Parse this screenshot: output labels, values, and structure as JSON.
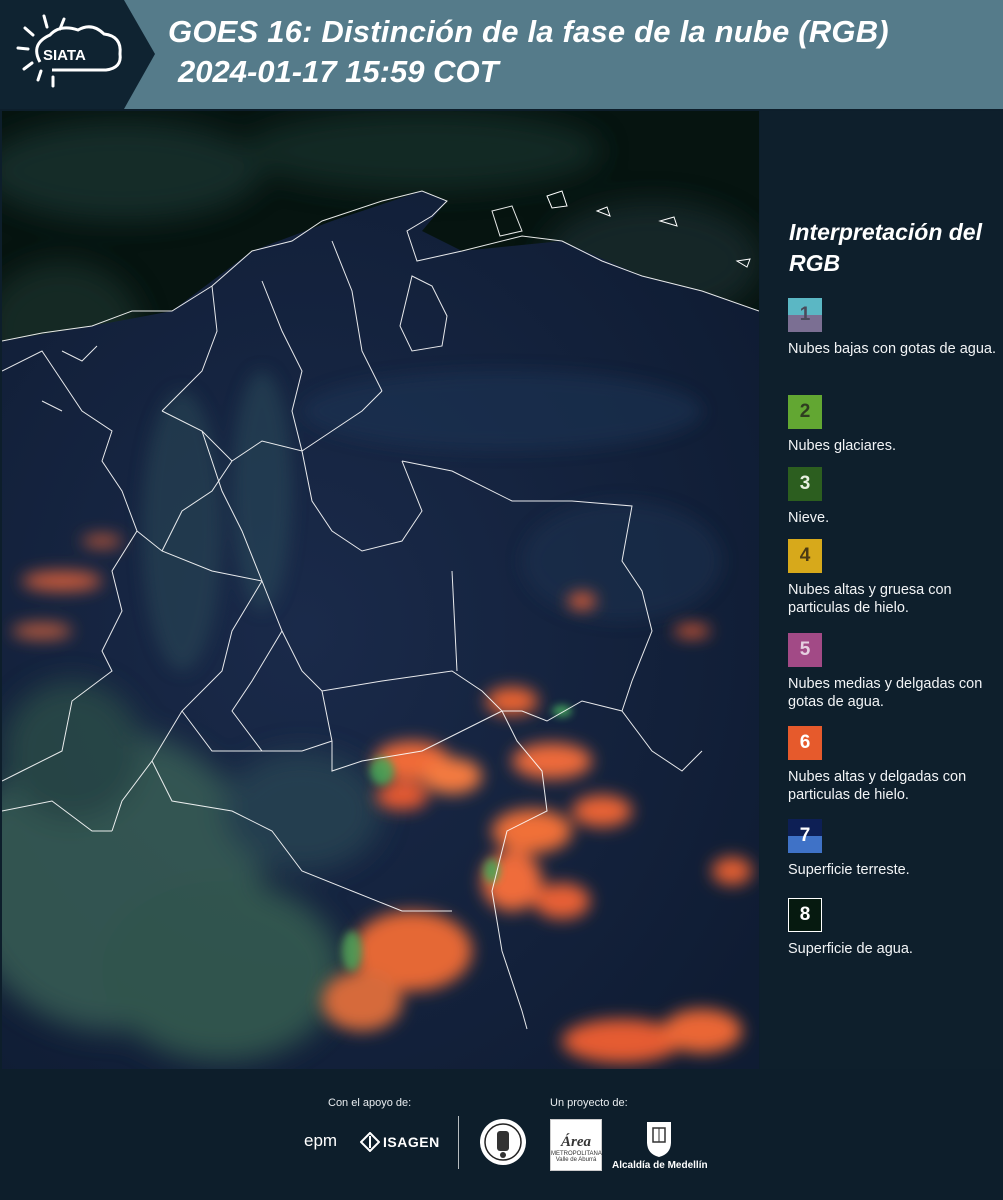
{
  "header": {
    "logo_text": "SIATA",
    "title_line1": "GOES 16: Distinción de la fase de la nube (RGB)",
    "title_line2": "2024-01-17 15:59 COT",
    "background_color": "#557b8a",
    "logo_panel_color": "#0f2331"
  },
  "map": {
    "icon": "satellite-map-image"
  },
  "legend": {
    "title": "Interpretación del RGB",
    "items": [
      {
        "number": "1",
        "label": "Nubes bajas con gotas de agua.",
        "colors": [
          "#5bb7c4",
          "#7b6f93"
        ]
      },
      {
        "number": "2",
        "label": "Nubes glaciares.",
        "colors": [
          "#62a732"
        ]
      },
      {
        "number": "3",
        "label": "Nieve.",
        "colors": [
          "#2c5e1f"
        ]
      },
      {
        "number": "4",
        "label": "Nubes altas y gruesa con particulas de hielo.",
        "colors": [
          "#d7a91b"
        ]
      },
      {
        "number": "5",
        "label": "Nubes medias y delgadas con gotas de agua.",
        "colors": [
          "#a24a86"
        ]
      },
      {
        "number": "6",
        "label": "Nubes altas y delgadas con particulas de hielo.",
        "colors": [
          "#e65a2c"
        ]
      },
      {
        "number": "7",
        "label": "Superficie terreste.",
        "colors": [
          "#0d1f55",
          "#3f72c7"
        ]
      },
      {
        "number": "8",
        "label": "Superficie de agua.",
        "colors": [
          "#061a10"
        ]
      }
    ]
  },
  "footer": {
    "support_label": "Con el apoyo de:",
    "project_label": "Un proyecto de:",
    "epm_text": "epm",
    "isagen_text": "ISAGEN",
    "area_text": "Área",
    "area_subtext": "METROPOLITANA Valle de Aburrá",
    "medellin_text": "Alcaldía de Medellín"
  }
}
